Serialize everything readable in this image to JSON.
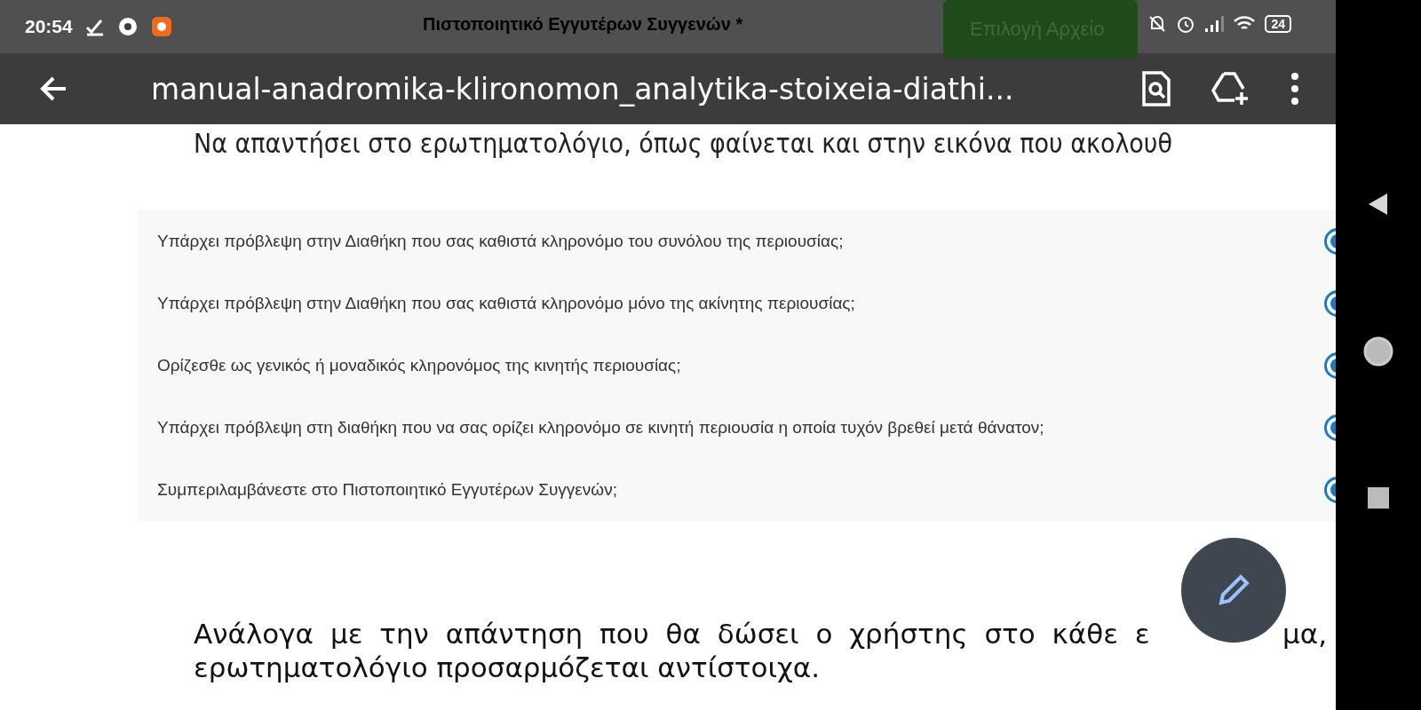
{
  "status_bar": {
    "time": "20:54",
    "background_title": "Πιστοποιητικό Εγγυτέρων Συγγενών *",
    "background_button": "Επιλογή Αρχείο",
    "battery": "24"
  },
  "toolbar": {
    "title": "manual-anadromika-klironomon_analytika-stoixeia-diathi..."
  },
  "document": {
    "intro": "Να απαντήσει στο ερωτηματολόγιο, όπως φαίνεται και στην εικόνα που ακολουθ",
    "questions": [
      {
        "text": "Υπάρχει πρόβλεψη στην Διαθήκη που σας καθιστά κληρονόμο του συνόλου της περιουσίας;",
        "selected": true
      },
      {
        "text": "Υπάρχει πρόβλεψη στην Διαθήκη που σας καθιστά κληρονόμο μόνο της ακίνητης περιουσίας;",
        "selected": true
      },
      {
        "text": "Ορίζεσθε ως γενικός ή μοναδικός κληρονόμος της κινητής περιουσίας;",
        "selected": true
      },
      {
        "text": "Υπάρχει πρόβλεψη στη διαθήκη που να σας ορίζει κληρονόμο σε κινητή περιουσία η οποία τυχόν βρεθεί μετά θάνατον;",
        "selected": true
      },
      {
        "text": "Συμπεριλαμβάνεστε στο Πιστοποιητικό Εγγυτέρων Συγγενών;",
        "selected": true
      }
    ],
    "paragraph_line_1_start": "Ανάλογα με την απάντηση που θα δώσει ο χρήστης στο κάθε ε",
    "paragraph_line_1_end": "μα,",
    "paragraph_line_2": "ερωτηματολόγιο προσαρμόζεται αντίστοιχα."
  }
}
